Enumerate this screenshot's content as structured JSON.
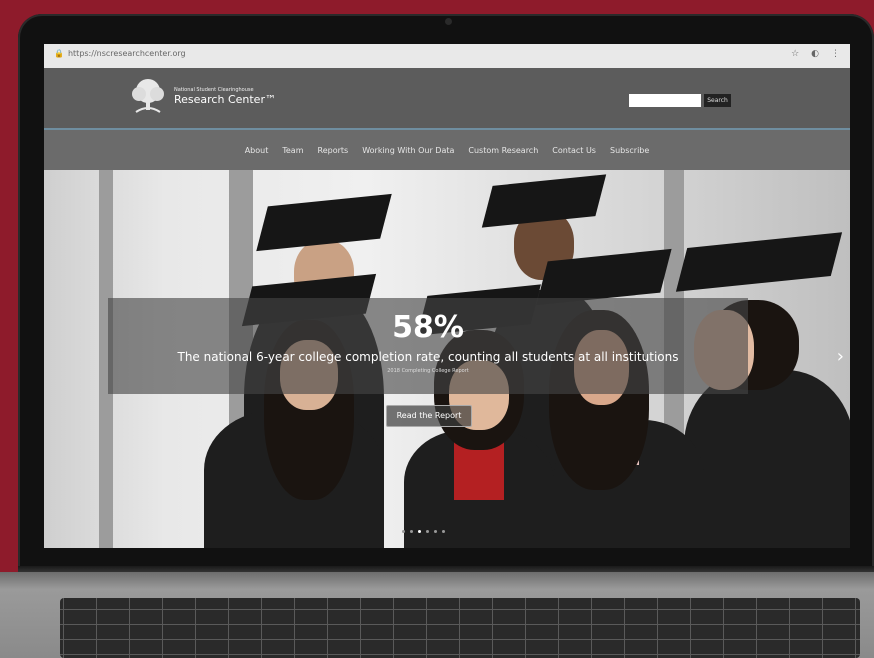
{
  "browser": {
    "url": "https://nscresearchcenter.org"
  },
  "header": {
    "logo_small": "National Student Clearinghouse",
    "logo_big": "Research Center™",
    "search_placeholder": "",
    "search_button": "Search"
  },
  "nav": {
    "items": [
      {
        "label": "About"
      },
      {
        "label": "Team"
      },
      {
        "label": "Reports"
      },
      {
        "label": "Working With Our Data"
      },
      {
        "label": "Custom Research"
      },
      {
        "label": "Contact Us"
      },
      {
        "label": "Subscribe"
      }
    ]
  },
  "hero": {
    "stat": "58%",
    "description": "The national 6-year college completion rate, counting all students at all institutions",
    "source": "2018 Completing College Report",
    "cta_label": "Read the Report",
    "slide_count": 6,
    "active_slide": 3
  },
  "colors": {
    "background": "#8e1b2b",
    "header": "#5c5c5c",
    "nav": "#6b6b6b"
  }
}
